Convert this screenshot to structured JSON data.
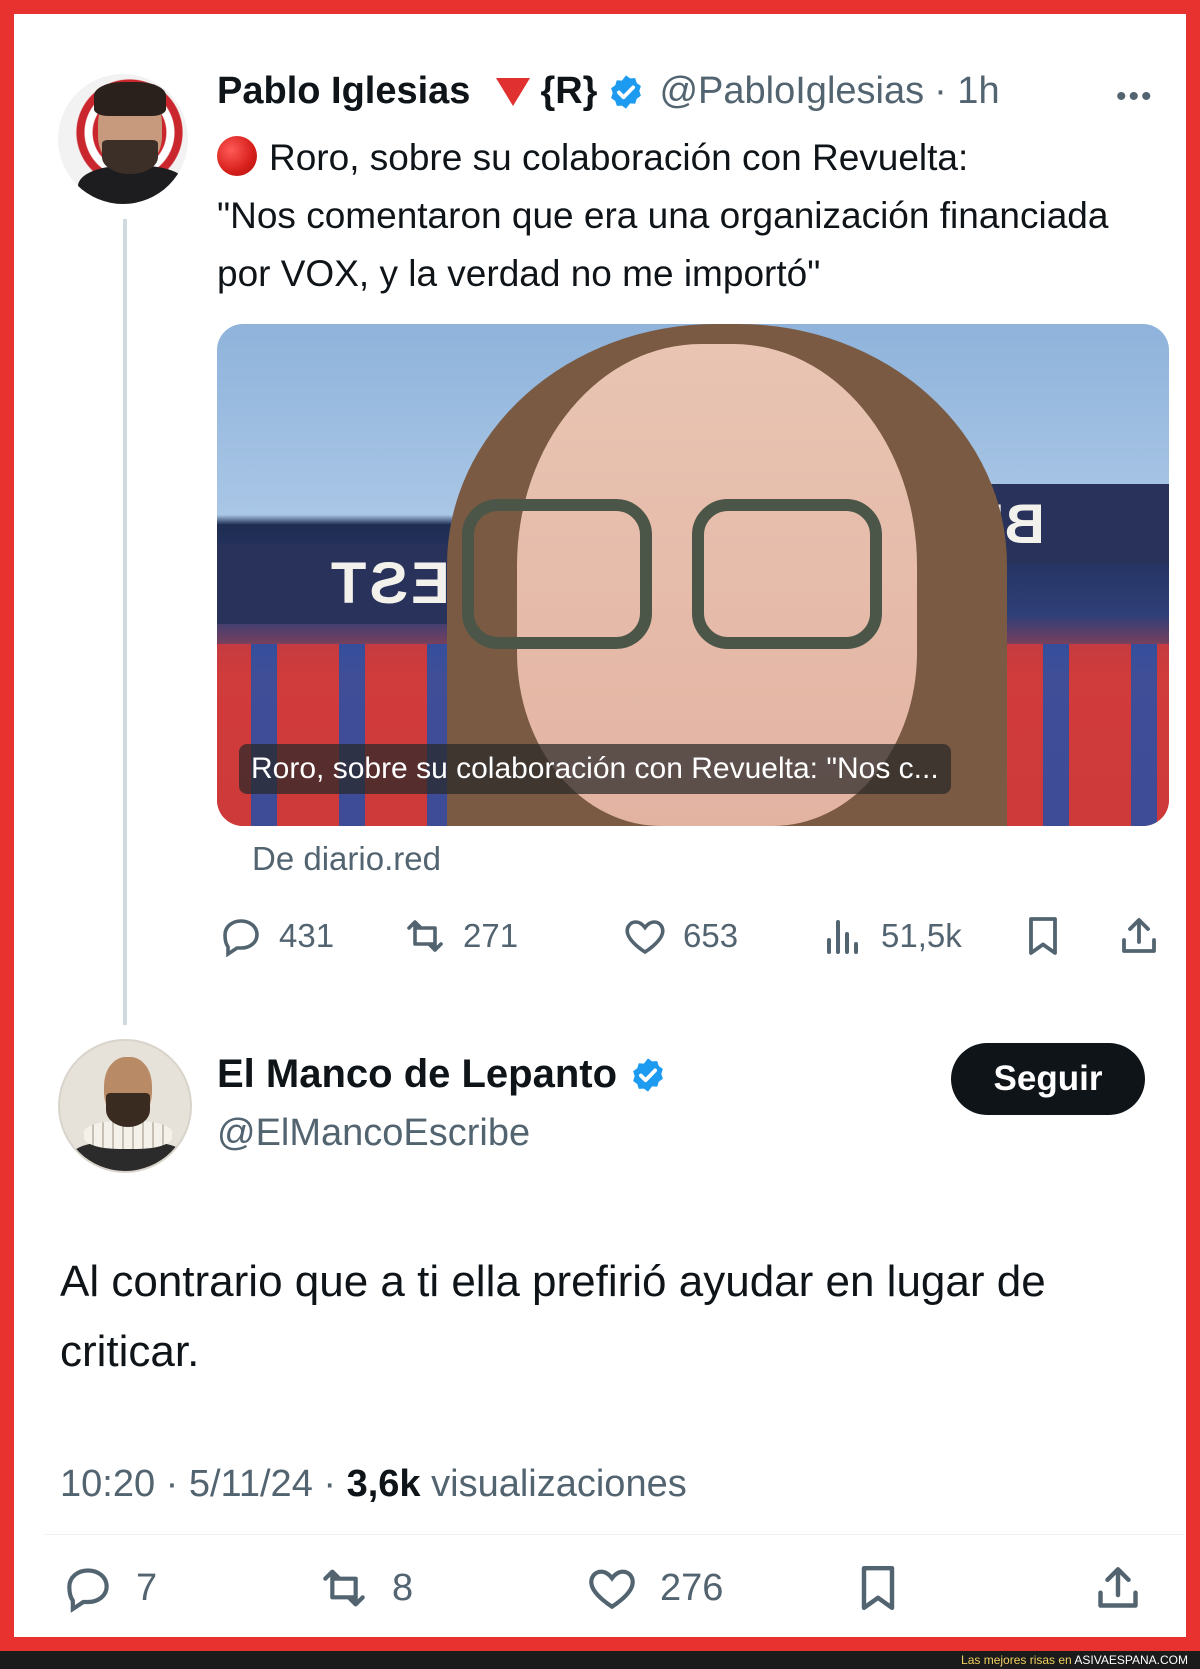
{
  "tweet1": {
    "author_name": "Pablo Iglesias",
    "author_tag": "{R}",
    "handle": "@PabloIglesias",
    "time": "· 1h",
    "text_line1": "Roro, sobre su colaboración con Revuelta:",
    "text_line2": "\"Nos comentaron que era una organización financiada por VOX, y la verdad no me importó\"",
    "media": {
      "caption": "Roro, sobre su colaboración con Revuelta: \"Nos c...",
      "sign_left": "L'EST",
      "sign_right": "BE"
    },
    "source": "De diario.red",
    "stats": {
      "replies": "431",
      "reposts": "271",
      "likes": "653",
      "views": "51,5k"
    }
  },
  "tweet2": {
    "author_name": "El Manco de Lepanto",
    "handle": "@ElMancoEscribe",
    "follow_label": "Seguir",
    "text": "Al contrario que a ti ella prefirió ayudar en lugar de criticar.",
    "time": "10:20 · 5/11/24 ·",
    "views_count": "3,6k",
    "views_label": "visualizaciones",
    "stats": {
      "replies": "7",
      "reposts": "8",
      "likes": "276"
    }
  },
  "footer": {
    "prefix": "Las mejores risas en",
    "site": "ASIVAESPANA.COM"
  },
  "colors": {
    "frame": "#e8322f",
    "verified": "#1d9bf0",
    "muted": "#536471",
    "text": "#0f1419"
  },
  "icons": [
    "more-icon",
    "reply-icon",
    "repost-icon",
    "like-icon",
    "views-icon",
    "bookmark-icon",
    "share-icon",
    "verified-icon",
    "red-triangle-icon",
    "red-circle-icon"
  ]
}
